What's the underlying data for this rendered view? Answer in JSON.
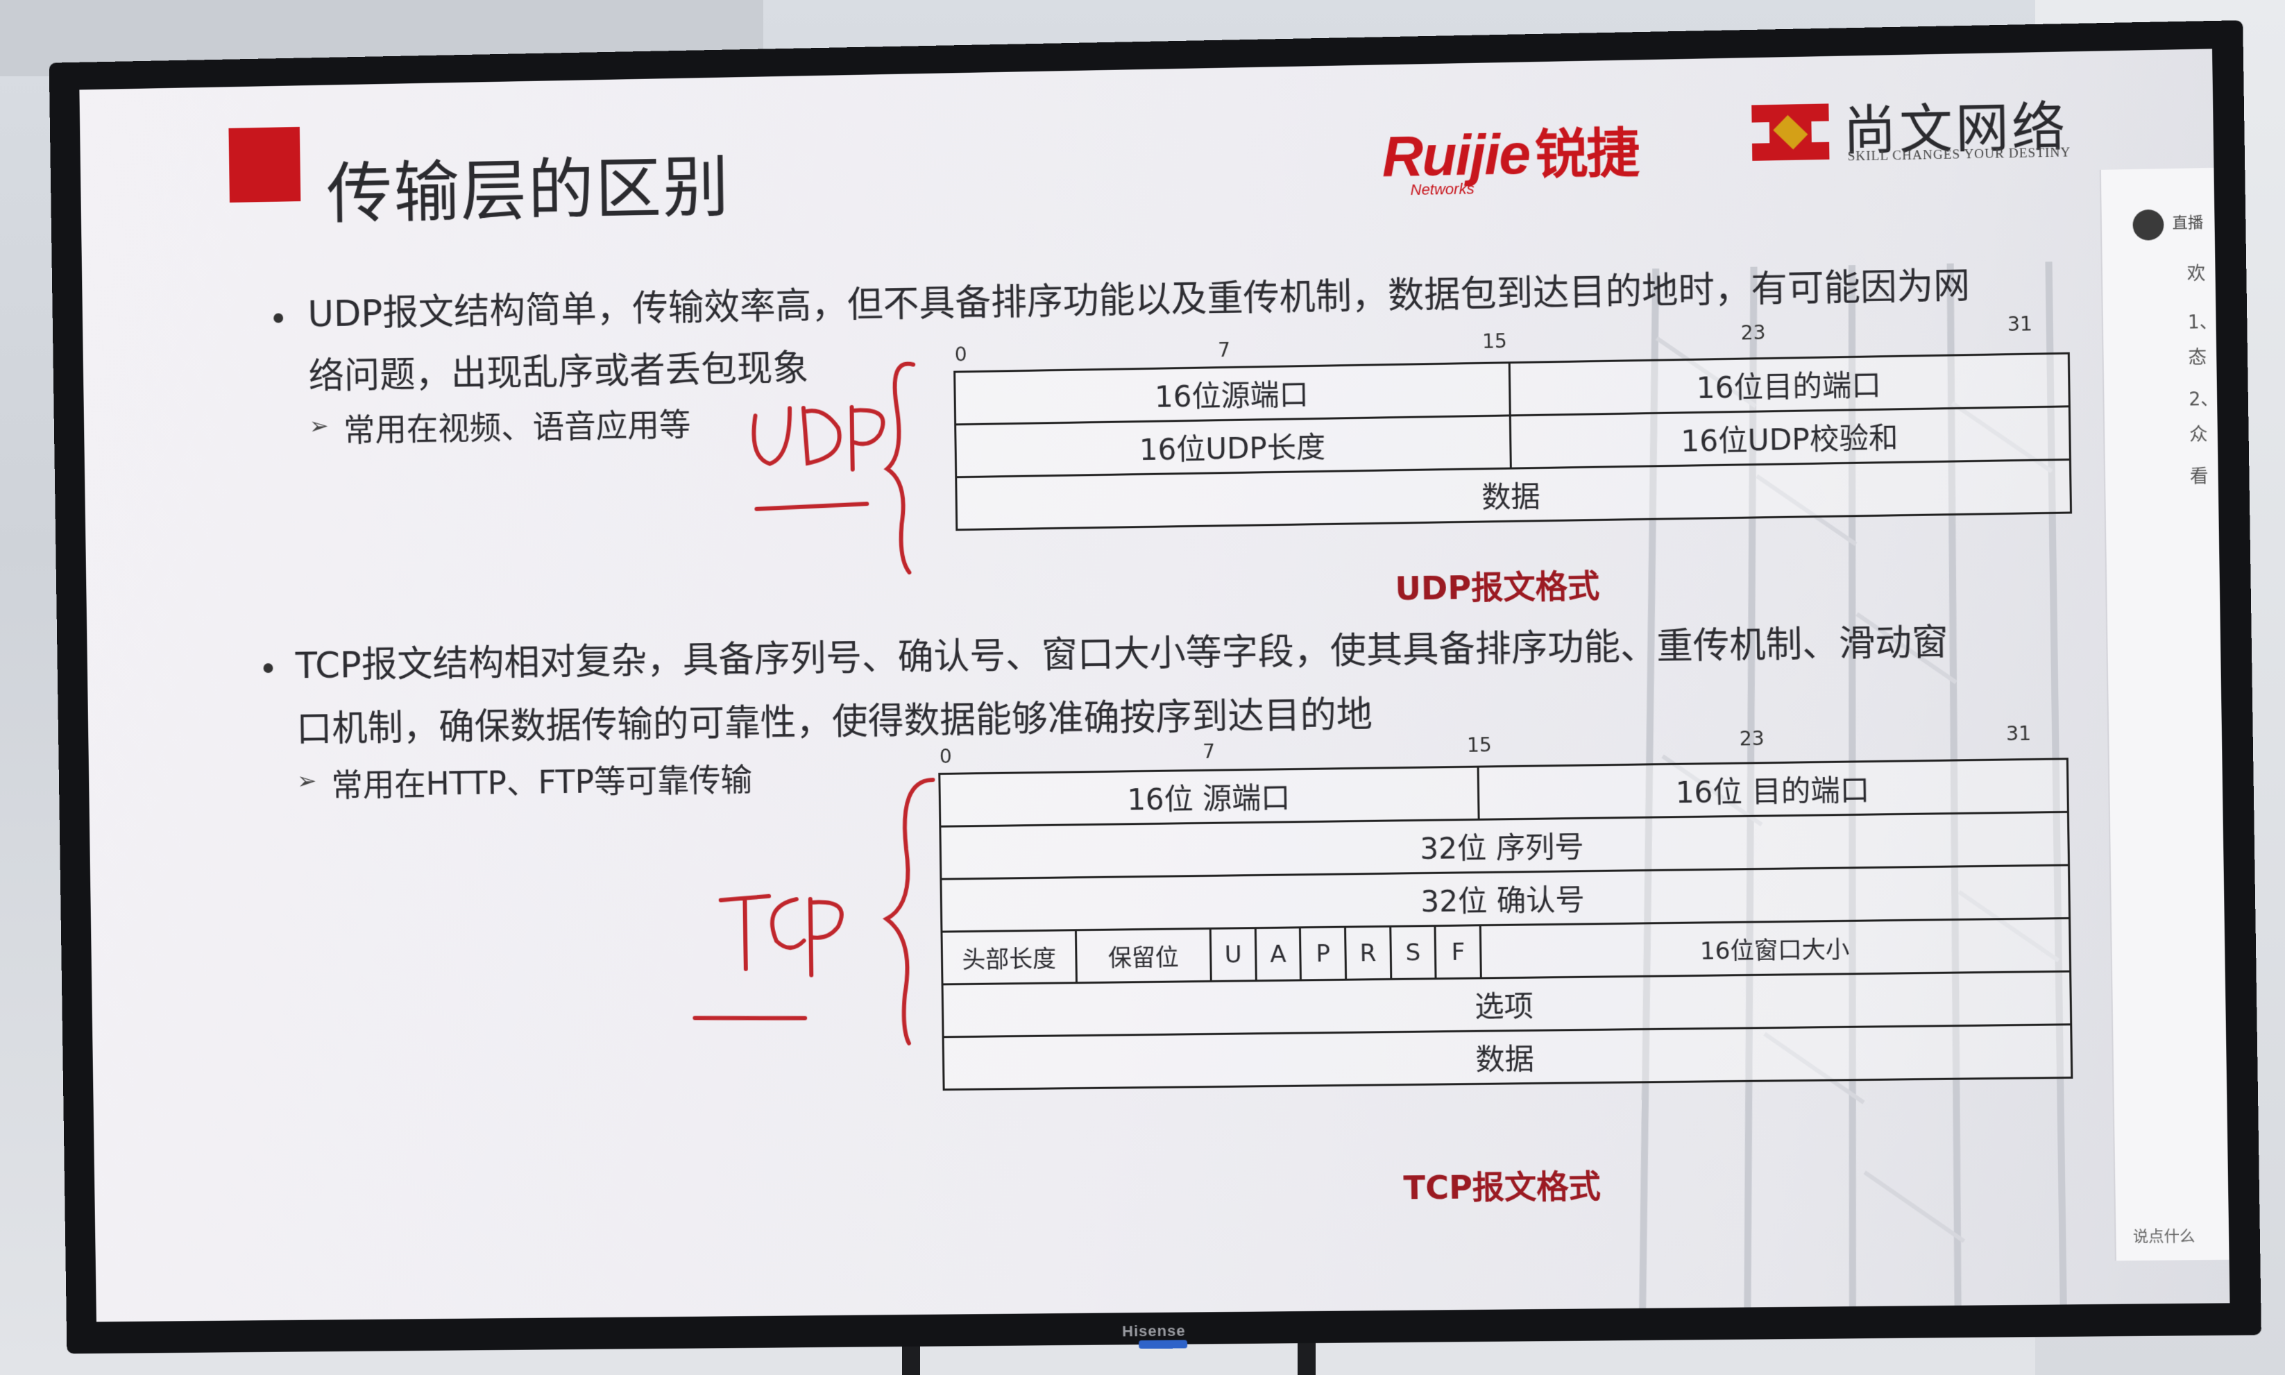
{
  "slide": {
    "title": "传输层的区别",
    "logos": {
      "ruijie_main": "Ruijie",
      "ruijie_cn": "锐捷",
      "ruijie_sub": "Networks",
      "school": "尚文网络",
      "school_sub": "SKILL CHANGES YOUR DESTINY"
    },
    "udp": {
      "bullet_line1": "UDP报文结构简单，传输效率高，但不具备排序功能以及重传机制，数据包到达目的地时，有可能因为网",
      "bullet_line2": "络问题，出现乱序或者丢包现象",
      "sub_bullet": "常用在视频、语音应用等",
      "bits": [
        "0",
        "7",
        "15",
        "23",
        "31"
      ],
      "row1": [
        "16位源端口",
        "16位目的端口"
      ],
      "row2": [
        "16位UDP长度",
        "16位UDP校验和"
      ],
      "row3": "数据",
      "caption": "UDP报文格式"
    },
    "tcp": {
      "bullet_line1": "TCP报文结构相对复杂，具备序列号、确认号、窗口大小等字段，使其具备排序功能、重传机制、滑动窗",
      "bullet_line2": "口机制，确保数据传输的可靠性，使得数据能够准确按序到达目的地",
      "sub_bullet": "常用在HTTP、FTP等可靠传输",
      "bits": [
        "0",
        "7",
        "15",
        "23",
        "31"
      ],
      "row1": [
        "16位 源端口",
        "16位 目的端口"
      ],
      "row2": "32位 序列号",
      "row3": "32位 确认号",
      "row4": [
        "头部长度",
        "保留位",
        "U",
        "A",
        "P",
        "R",
        "S",
        "F",
        "16位窗口大小"
      ],
      "row5": "选项",
      "row6": "数据",
      "caption": "TCP报文格式"
    }
  },
  "tv": {
    "brand": "Hisense"
  },
  "side_panel": {
    "header": "直播",
    "lines": [
      "欢",
      "1、",
      "态",
      "2、",
      "众",
      "看"
    ],
    "footer": "说点什么"
  },
  "colors": {
    "accent": "#c8161d",
    "caption": "#9b1a22",
    "ink": "#c0262c"
  },
  "icons": [
    "title-square-icon",
    "school-logo-icon",
    "bullet-dot-icon",
    "arrow-icon"
  ]
}
